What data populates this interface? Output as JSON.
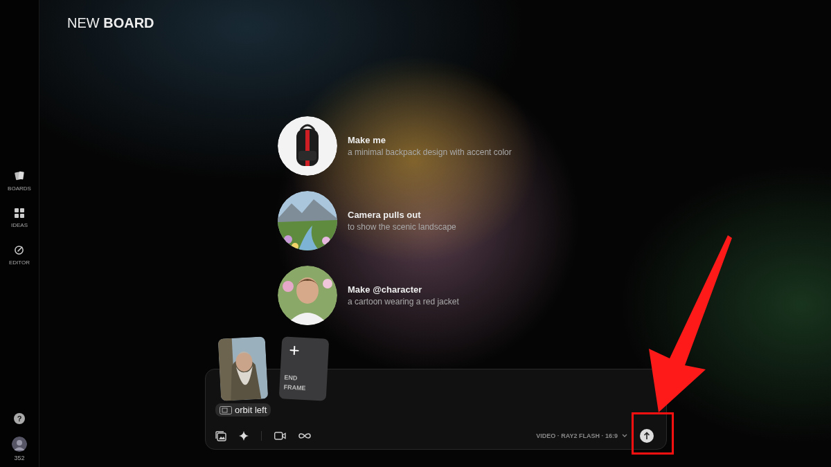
{
  "header": {
    "title": "NEW **BOARD**"
  },
  "sidebar": {
    "items": [
      {
        "kind": "boards",
        "label": "BOARDS"
      },
      {
        "kind": "ideas",
        "label": "IDEAS"
      },
      {
        "kind": "editor",
        "label": "EDITOR"
      }
    ],
    "help": "?",
    "credits": "352"
  },
  "suggestions": [
    {
      "kind": "backpack",
      "title": "Make me",
      "subtitle": "a minimal backpack design with accent color"
    },
    {
      "kind": "landscape",
      "title": "Camera pulls out",
      "subtitle": "to show the scenic landscape"
    },
    {
      "kind": "portrait",
      "title": "Make @character",
      "subtitle": "a cartoon wearing a red jacket"
    }
  ],
  "composer": {
    "end_frame": {
      "icon": "+",
      "label": "END\nFRAME"
    },
    "chip": "orbit left",
    "settings": "VIDEO · RAY2 FLASH · 16:9"
  },
  "callout": {
    "kind": "arrow-box"
  }
}
